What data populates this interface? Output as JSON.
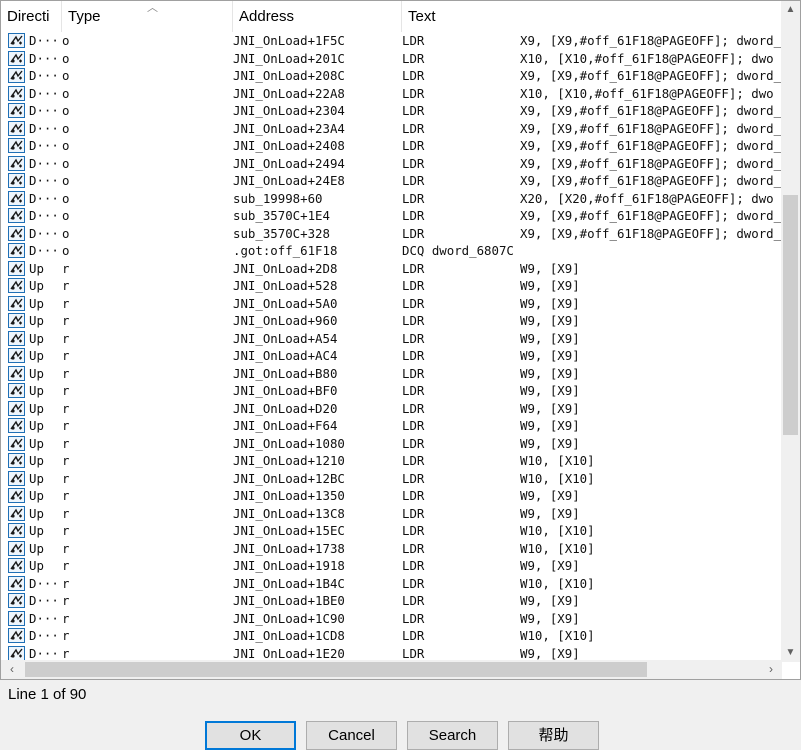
{
  "columns": {
    "direction": "Directi",
    "type": "Type",
    "address": "Address",
    "text": "Text"
  },
  "rows": [
    {
      "dir": "D···",
      "type": "o",
      "addr": "JNI_OnLoad+1F5C",
      "instr": "LDR",
      "ops": "X9, [X9,#off_61F18@PAGEOFF]; dword_"
    },
    {
      "dir": "D···",
      "type": "o",
      "addr": "JNI_OnLoad+201C",
      "instr": "LDR",
      "ops": "X10, [X10,#off_61F18@PAGEOFF]; dwo"
    },
    {
      "dir": "D···",
      "type": "o",
      "addr": "JNI_OnLoad+208C",
      "instr": "LDR",
      "ops": "X9, [X9,#off_61F18@PAGEOFF]; dword_"
    },
    {
      "dir": "D···",
      "type": "o",
      "addr": "JNI_OnLoad+22A8",
      "instr": "LDR",
      "ops": "X10, [X10,#off_61F18@PAGEOFF]; dwo"
    },
    {
      "dir": "D···",
      "type": "o",
      "addr": "JNI_OnLoad+2304",
      "instr": "LDR",
      "ops": "X9, [X9,#off_61F18@PAGEOFF]; dword_"
    },
    {
      "dir": "D···",
      "type": "o",
      "addr": "JNI_OnLoad+23A4",
      "instr": "LDR",
      "ops": "X9, [X9,#off_61F18@PAGEOFF]; dword_"
    },
    {
      "dir": "D···",
      "type": "o",
      "addr": "JNI_OnLoad+2408",
      "instr": "LDR",
      "ops": "X9, [X9,#off_61F18@PAGEOFF]; dword_"
    },
    {
      "dir": "D···",
      "type": "o",
      "addr": "JNI_OnLoad+2494",
      "instr": "LDR",
      "ops": "X9, [X9,#off_61F18@PAGEOFF]; dword_"
    },
    {
      "dir": "D···",
      "type": "o",
      "addr": "JNI_OnLoad+24E8",
      "instr": "LDR",
      "ops": "X9, [X9,#off_61F18@PAGEOFF]; dword_"
    },
    {
      "dir": "D···",
      "type": "o",
      "addr": "sub_19998+60",
      "instr": "LDR",
      "ops": "X20, [X20,#off_61F18@PAGEOFF]; dwo"
    },
    {
      "dir": "D···",
      "type": "o",
      "addr": "sub_3570C+1E4",
      "instr": "LDR",
      "ops": "X9, [X9,#off_61F18@PAGEOFF]; dword_"
    },
    {
      "dir": "D···",
      "type": "o",
      "addr": "sub_3570C+328",
      "instr": "LDR",
      "ops": "X9, [X9,#off_61F18@PAGEOFF]; dword_"
    },
    {
      "dir": "D···",
      "type": "o",
      "addr": ".got:off_61F18",
      "instr": "DCQ dword_6807C",
      "ops": ""
    },
    {
      "dir": "Up",
      "type": "r",
      "addr": "JNI_OnLoad+2D8",
      "instr": "LDR",
      "ops": "W9, [X9]"
    },
    {
      "dir": "Up",
      "type": "r",
      "addr": "JNI_OnLoad+528",
      "instr": "LDR",
      "ops": "W9, [X9]"
    },
    {
      "dir": "Up",
      "type": "r",
      "addr": "JNI_OnLoad+5A0",
      "instr": "LDR",
      "ops": "W9, [X9]"
    },
    {
      "dir": "Up",
      "type": "r",
      "addr": "JNI_OnLoad+960",
      "instr": "LDR",
      "ops": "W9, [X9]"
    },
    {
      "dir": "Up",
      "type": "r",
      "addr": "JNI_OnLoad+A54",
      "instr": "LDR",
      "ops": "W9, [X9]"
    },
    {
      "dir": "Up",
      "type": "r",
      "addr": "JNI_OnLoad+AC4",
      "instr": "LDR",
      "ops": "W9, [X9]"
    },
    {
      "dir": "Up",
      "type": "r",
      "addr": "JNI_OnLoad+B80",
      "instr": "LDR",
      "ops": "W9, [X9]"
    },
    {
      "dir": "Up",
      "type": "r",
      "addr": "JNI_OnLoad+BF0",
      "instr": "LDR",
      "ops": "W9, [X9]"
    },
    {
      "dir": "Up",
      "type": "r",
      "addr": "JNI_OnLoad+D20",
      "instr": "LDR",
      "ops": "W9, [X9]"
    },
    {
      "dir": "Up",
      "type": "r",
      "addr": "JNI_OnLoad+F64",
      "instr": "LDR",
      "ops": "W9, [X9]"
    },
    {
      "dir": "Up",
      "type": "r",
      "addr": "JNI_OnLoad+1080",
      "instr": "LDR",
      "ops": "W9, [X9]"
    },
    {
      "dir": "Up",
      "type": "r",
      "addr": "JNI_OnLoad+1210",
      "instr": "LDR",
      "ops": "W10, [X10]"
    },
    {
      "dir": "Up",
      "type": "r",
      "addr": "JNI_OnLoad+12BC",
      "instr": "LDR",
      "ops": "W10, [X10]"
    },
    {
      "dir": "Up",
      "type": "r",
      "addr": "JNI_OnLoad+1350",
      "instr": "LDR",
      "ops": "W9, [X9]"
    },
    {
      "dir": "Up",
      "type": "r",
      "addr": "JNI_OnLoad+13C8",
      "instr": "LDR",
      "ops": "W9, [X9]"
    },
    {
      "dir": "Up",
      "type": "r",
      "addr": "JNI_OnLoad+15EC",
      "instr": "LDR",
      "ops": "W10, [X10]"
    },
    {
      "dir": "Up",
      "type": "r",
      "addr": "JNI_OnLoad+1738",
      "instr": "LDR",
      "ops": "W10, [X10]"
    },
    {
      "dir": "Up",
      "type": "r",
      "addr": "JNI_OnLoad+1918",
      "instr": "LDR",
      "ops": "W9, [X9]"
    },
    {
      "dir": "D···",
      "type": "r",
      "addr": "JNI_OnLoad+1B4C",
      "instr": "LDR",
      "ops": "W10, [X10]"
    },
    {
      "dir": "D···",
      "type": "r",
      "addr": "JNI_OnLoad+1BE0",
      "instr": "LDR",
      "ops": "W9, [X9]"
    },
    {
      "dir": "D···",
      "type": "r",
      "addr": "JNI_OnLoad+1C90",
      "instr": "LDR",
      "ops": "W9, [X9]"
    },
    {
      "dir": "D···",
      "type": "r",
      "addr": "JNI_OnLoad+1CD8",
      "instr": "LDR",
      "ops": "W10, [X10]"
    },
    {
      "dir": "D···",
      "type": "r",
      "addr": "JNI_OnLoad+1E20",
      "instr": "LDR",
      "ops": "W9, [X9]"
    }
  ],
  "row_icon": "xref-icon",
  "status": "Line 1 of 90",
  "buttons": {
    "ok": "OK",
    "cancel": "Cancel",
    "search": "Search",
    "help": "帮助"
  },
  "colors": {
    "default_button_border": "#0078d7",
    "icon_border": "#1f6fb5"
  }
}
